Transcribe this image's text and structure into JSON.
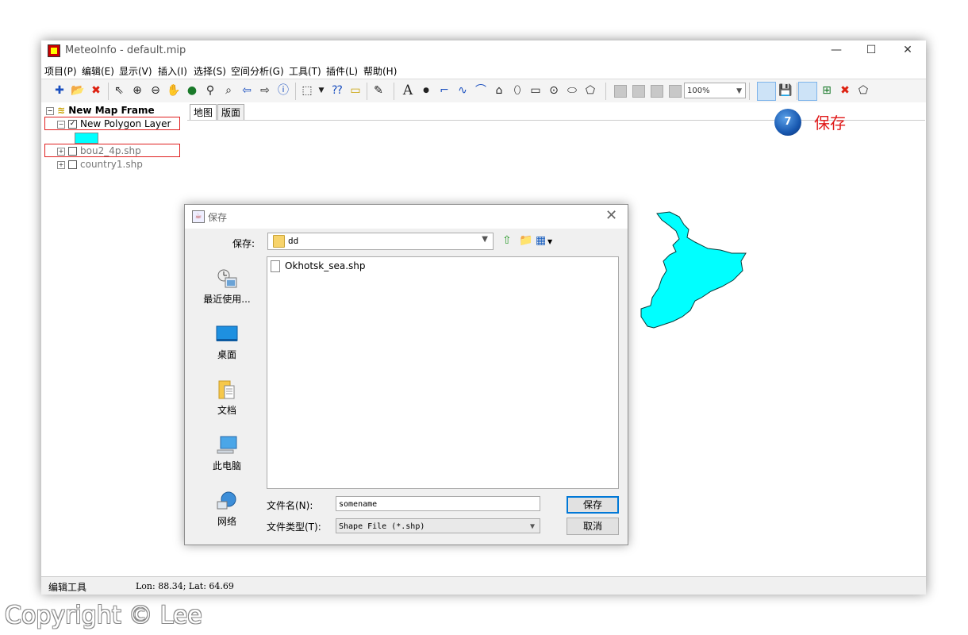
{
  "window": {
    "title": "MeteoInfo - default.mip",
    "min": "—",
    "max": "☐",
    "close": "✕"
  },
  "menu": [
    "项目(P)",
    "编辑(E)",
    "显示(V)",
    "插入(I)",
    "选择(S)",
    "空间分析(G)",
    "工具(T)",
    "插件(L)",
    "帮助(H)"
  ],
  "toolbar": {
    "zoom_value": "100%"
  },
  "legend": {
    "frame": "New Map Frame",
    "layers": [
      {
        "name": "New Polygon Layer",
        "checked": true
      },
      {
        "name": "bou2_4p.shp",
        "checked": false
      },
      {
        "name": "country1.shp",
        "checked": false
      }
    ]
  },
  "tabs": {
    "map": "地图",
    "layout": "版面"
  },
  "annotation": {
    "step": "7",
    "label": "保存"
  },
  "dialog": {
    "title": "保存",
    "lookin_label": "保存:",
    "lookin_value": "dd",
    "places": [
      "最近使用...",
      "桌面",
      "文档",
      "此电脑",
      "网络"
    ],
    "files": [
      "Okhotsk_sea.shp"
    ],
    "filename_label": "文件名(N):",
    "filename_value": "somename",
    "filetype_label": "文件类型(T):",
    "filetype_value": "Shape File (*.shp)",
    "save_button": "保存",
    "cancel_button": "取消"
  },
  "status": {
    "tool": "编辑工具",
    "coords": "Lon: 88.34; Lat: 64.69"
  },
  "copyright": "Copyright © Lee",
  "colors": {
    "polygon_fill": "#00ffff",
    "annotation_red": "#e01818",
    "focus_blue": "#0078d7"
  }
}
